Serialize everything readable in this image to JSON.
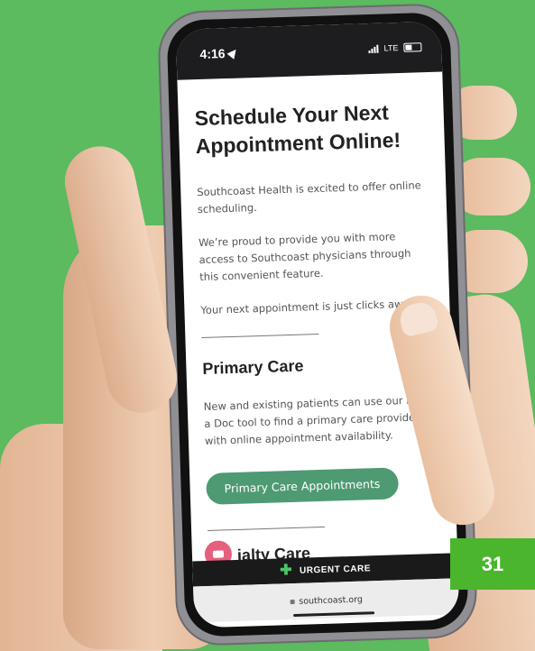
{
  "status": {
    "time": "4:16",
    "carrier": "LTE"
  },
  "page": {
    "title": "Schedule Your Next Appointment Online!",
    "intro_1": "Southcoast Health is excited to offer online scheduling.",
    "intro_2": "We’re proud to provide you with more access to Southcoast physicians through this convenient feature.",
    "intro_3": "Your next appointment is just clicks away!",
    "primary_title": "Primary Care",
    "primary_text": "New and existing patients can use our Find a Doc tool to find a primary care provider with online appointment availability.",
    "primary_button": "Primary Care Appointments",
    "specialty_title_visible": "ialty Care"
  },
  "bottom": {
    "urgent_label": "URGENT CARE",
    "url": "southcoast.org"
  },
  "badge": {
    "number": "31"
  },
  "colors": {
    "background": "#5cba5f",
    "button": "#4e9a72",
    "chat": "#e6607e",
    "badge": "#4bb52e",
    "plus": "#4dc36a"
  }
}
